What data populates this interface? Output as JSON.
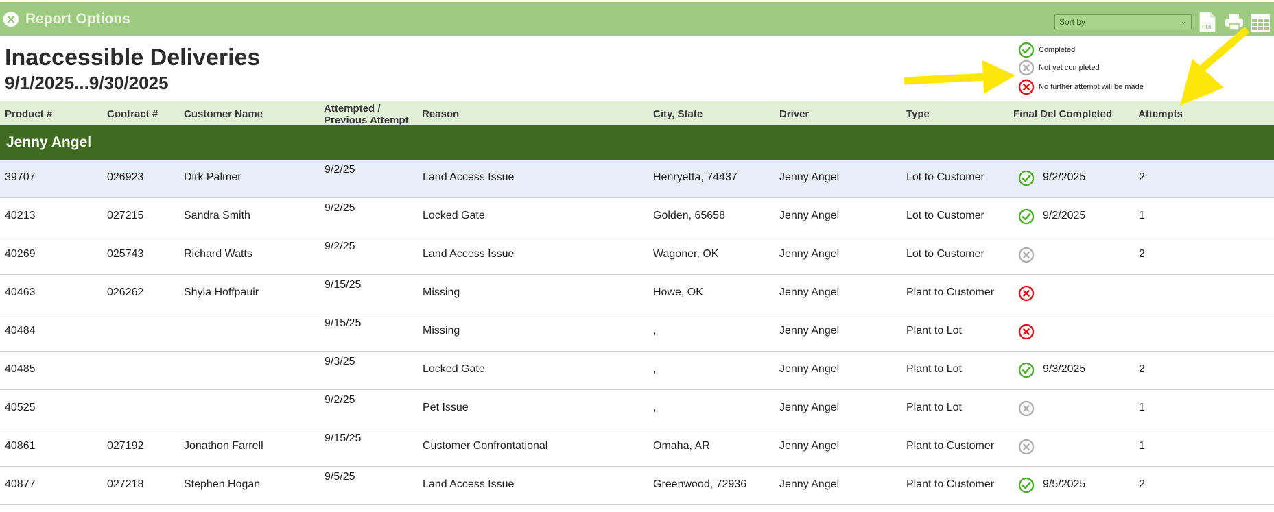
{
  "toolbar": {
    "title": "Report Options",
    "sort_by_placeholder": "Sort by",
    "pdf_icon_label": "PDF"
  },
  "report": {
    "title": "Inaccessible Deliveries",
    "range": "9/1/2025...9/30/2025"
  },
  "legend": {
    "completed": "Completed",
    "not_yet": "Not yet completed",
    "no_further": "No further attempt will be made"
  },
  "columns": {
    "product": "Product #",
    "contract": "Contract #",
    "customer": "Customer Name",
    "attempted_line1": "Attempted /",
    "attempted_line2": "Previous Attempt",
    "reason": "Reason",
    "city": "City, State",
    "driver": "Driver",
    "type": "Type",
    "final": "Final Del Completed",
    "attempts": "Attempts"
  },
  "group": {
    "name": "Jenny Angel"
  },
  "colors": {
    "topbar": "#9dcb7f",
    "group_header": "#3f6b20",
    "header_band": "#e3f0d8",
    "highlight_row": "#e8eef8",
    "completed": "#4caf2a",
    "not_yet": "#b0b0b0",
    "no_further": "#d9161c",
    "arrow": "#ffe60a"
  },
  "rows": [
    {
      "product": "39707",
      "contract": "026923",
      "customer": "Dirk Palmer",
      "attempted": "9/2/25",
      "reason": "Land Access Issue",
      "city": "Henryetta, 74437",
      "driver": "Jenny Angel",
      "type": "Lot to Customer",
      "status": "completed",
      "final": "9/2/2025",
      "attempts": "2",
      "highlight": true
    },
    {
      "product": "40213",
      "contract": "027215",
      "customer": "Sandra Smith",
      "attempted": "9/2/25",
      "reason": "Locked Gate",
      "city": "Golden, 65658",
      "driver": "Jenny Angel",
      "type": "Lot to Customer",
      "status": "completed",
      "final": "9/2/2025",
      "attempts": "1",
      "highlight": false
    },
    {
      "product": "40269",
      "contract": "025743",
      "customer": "Richard Watts",
      "attempted": "9/2/25",
      "reason": "Land Access Issue",
      "city": "Wagoner, OK",
      "driver": "Jenny Angel",
      "type": "Lot to Customer",
      "status": "not_yet",
      "final": "",
      "attempts": "2",
      "highlight": false
    },
    {
      "product": "40463",
      "contract": "026262",
      "customer": "Shyla Hoffpauir",
      "attempted": "9/15/25",
      "reason": "Missing",
      "city": "Howe, OK",
      "driver": "Jenny Angel",
      "type": "Plant to Customer",
      "status": "no_further",
      "final": "",
      "attempts": "",
      "highlight": false
    },
    {
      "product": "40484",
      "contract": "",
      "customer": "",
      "attempted": "9/15/25",
      "reason": "Missing",
      "city": ",",
      "driver": "Jenny Angel",
      "type": "Plant to Lot",
      "status": "no_further",
      "final": "",
      "attempts": "",
      "highlight": false
    },
    {
      "product": "40485",
      "contract": "",
      "customer": "",
      "attempted": "9/3/25",
      "reason": "Locked Gate",
      "city": ",",
      "driver": "Jenny Angel",
      "type": "Plant to Lot",
      "status": "completed",
      "final": "9/3/2025",
      "attempts": "2",
      "highlight": false
    },
    {
      "product": "40525",
      "contract": "",
      "customer": "",
      "attempted": "9/2/25",
      "reason": "Pet Issue",
      "city": ",",
      "driver": "Jenny Angel",
      "type": "Plant to Lot",
      "status": "not_yet",
      "final": "",
      "attempts": "1",
      "highlight": false
    },
    {
      "product": "40861",
      "contract": "027192",
      "customer": "Jonathon Farrell",
      "attempted": "9/15/25",
      "reason": "Customer Confrontational",
      "city": "Omaha, AR",
      "driver": "Jenny Angel",
      "type": "Plant to Customer",
      "status": "not_yet",
      "final": "",
      "attempts": "1",
      "highlight": false
    },
    {
      "product": "40877",
      "contract": "027218",
      "customer": "Stephen Hogan",
      "attempted": "9/5/25",
      "reason": "Land Access Issue",
      "city": "Greenwood, 72936",
      "driver": "Jenny Angel",
      "type": "Plant to Customer",
      "status": "completed",
      "final": "9/5/2025",
      "attempts": "2",
      "highlight": false
    }
  ]
}
